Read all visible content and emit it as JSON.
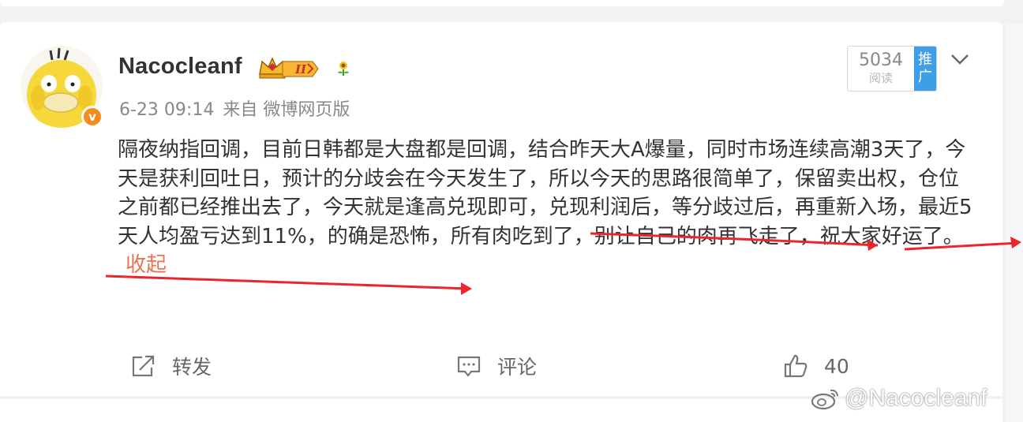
{
  "author": {
    "name": "Nacocleanf",
    "verified_mark": "v",
    "level_badge": "II"
  },
  "meta": {
    "timestamp": "6-23 09:14",
    "source": "来自 微博网页版"
  },
  "reads": {
    "count": "5034",
    "label": "阅读",
    "promote": "推广"
  },
  "post": {
    "text": "隔夜纳指回调，目前日韩都是大盘都是回调，结合昨天大A爆量，同时市场连续高潮3天了，今天是获利回吐日，预计的分歧会在今天发生了，所以今天的思路很简单了，保留卖出权，仓位之前都已经推出去了，今天就是逢高兑现即可，兑现利润后，等分歧过后，再重新入场，最近5天人均盈亏达到11%，的确是恐怖，所有肉吃到了，别让自己的肉再飞走了，祝大家好运了。",
    "collapse_label": "收起"
  },
  "actions": {
    "forward_label": "转发",
    "comment_label": "评论",
    "like_count": "40"
  },
  "watermark": {
    "text": "@Nacocleanf"
  },
  "colors": {
    "link": "#eb7350",
    "promo": "#3f9ee8",
    "annotation": "#e8262b",
    "verified": "#f28c1e"
  },
  "icons": [
    "verified-badge-icon",
    "vip-crown-badge-icon",
    "sunflower-icon",
    "chevron-down-icon",
    "forward-icon",
    "comment-icon",
    "like-thumb-icon",
    "weibo-logo-icon"
  ]
}
